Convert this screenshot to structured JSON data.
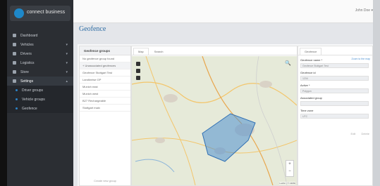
{
  "app": {
    "name": "connect business"
  },
  "header": {
    "user": "John Doe ▾",
    "page_title": "Geofence"
  },
  "sidebar": {
    "items": [
      {
        "label": "Dashboard",
        "icon": "dashboard-icon"
      },
      {
        "label": "Vehicles",
        "icon": "car-icon"
      },
      {
        "label": "Drivers",
        "icon": "driver-icon"
      },
      {
        "label": "Logistics",
        "icon": "pin-icon"
      },
      {
        "label": "Store",
        "icon": "cart-icon"
      },
      {
        "label": "Settings",
        "icon": "gear-icon"
      }
    ],
    "subitems": [
      {
        "label": "Driver groups"
      },
      {
        "label": "Vehicle groups"
      },
      {
        "label": "Geofence"
      }
    ]
  },
  "groups": {
    "header": "Geofence groups",
    "items": [
      "No geofence group found",
      "+ Unassociated geofences",
      "Geofence Stuttgart Test",
      "Landkreise GP",
      "Munich east",
      "Munich west",
      "B27 Rechargeable",
      "Stuttgart main"
    ],
    "footer": "Create new group"
  },
  "map": {
    "tabs": [
      "Map",
      "Search"
    ],
    "attribution": "Leaflet | © HERE"
  },
  "form": {
    "tab": "Geofence",
    "link": "Zoom to the map",
    "fields": [
      {
        "label": "Geofence name *",
        "value": "Geofence Stuttgart Test"
      },
      {
        "label": "Geofence id",
        "value": "1234"
      },
      {
        "label": "Active *",
        "value": "Polygon"
      },
      {
        "label": "Associated group",
        "value": ""
      },
      {
        "label": "Time zone",
        "value": "UTC"
      }
    ],
    "actions": [
      "Edit",
      "Delete"
    ]
  },
  "colors": {
    "accent": "#2d83c6",
    "sidebar": "#2b2e33",
    "polygon": "#3f8fd0"
  }
}
